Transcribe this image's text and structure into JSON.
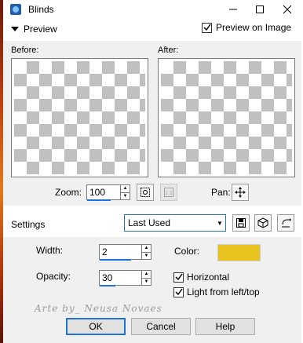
{
  "window": {
    "title": "Blinds"
  },
  "preview": {
    "toggle_label": "Preview",
    "preview_on_image_label": "Preview on Image",
    "preview_on_image_checked": true,
    "before_label": "Before:",
    "after_label": "After:",
    "zoom_label": "Zoom:",
    "zoom_value": "100",
    "pan_label": "Pan:"
  },
  "settings": {
    "label": "Settings",
    "preset_value": "Last Used"
  },
  "params": {
    "width_label": "Width:",
    "width_value": "2",
    "opacity_label": "Opacity:",
    "opacity_value": "30",
    "color_label": "Color:",
    "color_hex": "#e8c21e",
    "horizontal_label": "Horizontal",
    "horizontal_checked": true,
    "light_label": "Light from left/top",
    "light_checked": true
  },
  "watermark": "Arte by_ Neusa Novaes",
  "buttons": {
    "ok": "OK",
    "cancel": "Cancel",
    "help": "Help"
  }
}
